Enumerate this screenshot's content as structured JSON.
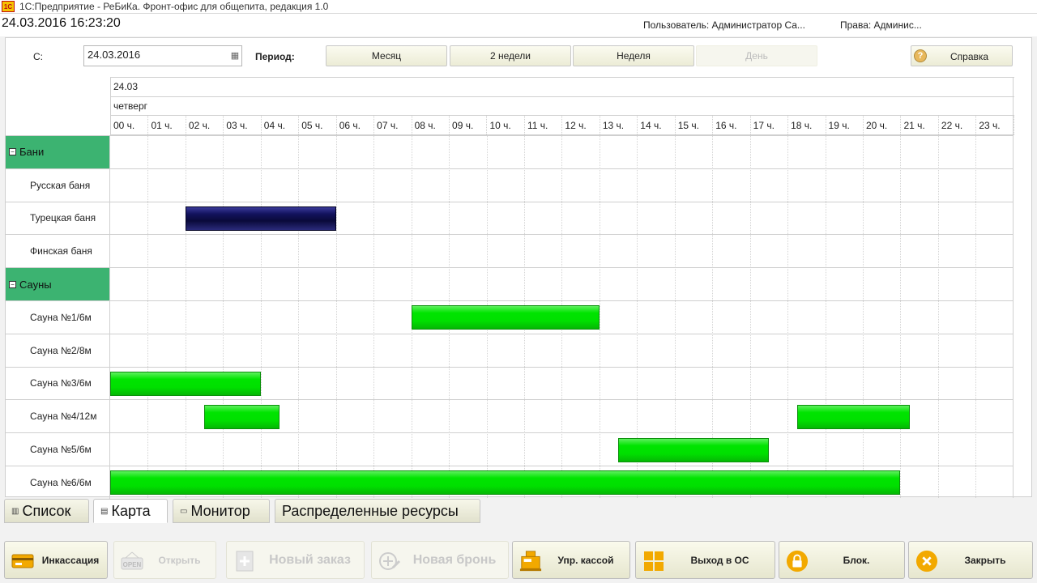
{
  "window": {
    "title": "1С:Предприятие - РеБиКа. Фронт-офис для общепита, редакция 1.0",
    "logo": "1С"
  },
  "header": {
    "datetime": "24.03.2016 16:23:20",
    "user": "Пользователь: Администратор Са...",
    "rights": "Права:  Админис..."
  },
  "filter": {
    "date_label": "С:",
    "date_value": "24.03.2016",
    "period_label": "Период:",
    "calendar_icon": "calendar-icon"
  },
  "period_buttons": [
    {
      "label": "Месяц",
      "enabled": true
    },
    {
      "label": "2 недели",
      "enabled": true
    },
    {
      "label": "Неделя",
      "enabled": true
    },
    {
      "label": "День",
      "enabled": false
    }
  ],
  "help": {
    "label": "Справка",
    "icon": "?"
  },
  "schedule": {
    "date": "24.03",
    "weekday": "четверг",
    "hours": [
      "00 ч.",
      "01 ч.",
      "02 ч.",
      "03 ч.",
      "04 ч.",
      "05 ч.",
      "06 ч.",
      "07 ч.",
      "08 ч.",
      "09 ч.",
      "10 ч.",
      "11 ч.",
      "12 ч.",
      "13 ч.",
      "14 ч.",
      "15 ч.",
      "16 ч.",
      "17 ч.",
      "18 ч.",
      "19 ч.",
      "20 ч.",
      "21 ч.",
      "22 ч.",
      "23 ч."
    ],
    "rows": [
      {
        "type": "group",
        "label": "Бани",
        "expand": "⊟"
      },
      {
        "type": "resource",
        "label": "Русская баня",
        "bookings": []
      },
      {
        "type": "resource",
        "label": "Турецкая баня",
        "bookings": [
          {
            "start": 2.0,
            "end": 6.0,
            "color": "#0f0f4a",
            "style": "dark"
          }
        ]
      },
      {
        "type": "resource",
        "label": "Финская баня",
        "bookings": []
      },
      {
        "type": "group",
        "label": "Сауны",
        "expand": "⊟"
      },
      {
        "type": "resource",
        "label": "Сауна №1/6м",
        "bookings": [
          {
            "start": 8.0,
            "end": 13.0,
            "color": "#00e000"
          }
        ]
      },
      {
        "type": "resource",
        "label": "Сауна №2/8м",
        "bookings": []
      },
      {
        "type": "resource",
        "label": "Сауна №3/6м",
        "bookings": [
          {
            "start": 0.0,
            "end": 4.0,
            "color": "#00e000"
          }
        ]
      },
      {
        "type": "resource",
        "label": "Сауна №4/12м",
        "bookings": [
          {
            "start": 2.5,
            "end": 4.5,
            "color": "#00e000"
          },
          {
            "start": 18.25,
            "end": 21.25,
            "color": "#00e000"
          }
        ]
      },
      {
        "type": "resource",
        "label": "Сауна №5/6м",
        "bookings": [
          {
            "start": 13.5,
            "end": 17.5,
            "color": "#00e000"
          }
        ]
      },
      {
        "type": "resource",
        "label": "Сауна №6/6м",
        "bookings": [
          {
            "start": 0.0,
            "end": 21.0,
            "color": "#00e000"
          }
        ]
      }
    ]
  },
  "tabs": [
    {
      "label": "Список",
      "icon": "list-icon",
      "active": false
    },
    {
      "label": "Карта",
      "icon": "map-icon",
      "active": true
    },
    {
      "label": "Монитор",
      "icon": "monitor-icon",
      "active": false
    },
    {
      "label": "Распределенные ресурсы",
      "icon": "",
      "active": false
    }
  ],
  "actions": [
    {
      "label": "Инкассация",
      "icon": "cash-card-icon",
      "enabled": true
    },
    {
      "label": "Открыть",
      "icon": "open-sign-icon",
      "enabled": false
    },
    {
      "label": "Новый заказ",
      "icon": "new-order-icon",
      "enabled": false
    },
    {
      "label": "Новая бронь",
      "icon": "new-booking-icon",
      "enabled": false
    },
    {
      "label": "Упр. кассой",
      "icon": "cash-register-icon",
      "enabled": true
    },
    {
      "label": "Выход в ОС",
      "icon": "windows-logo-icon",
      "enabled": true
    },
    {
      "label": "Блок.",
      "icon": "lock-icon",
      "enabled": true
    },
    {
      "label": "Закрыть",
      "icon": "close-icon",
      "enabled": true
    }
  ],
  "colors": {
    "group_bg": "#3cb371",
    "booking": "#00e000",
    "booking_dark": "#0f0f4a",
    "accent": "#e8b000"
  }
}
